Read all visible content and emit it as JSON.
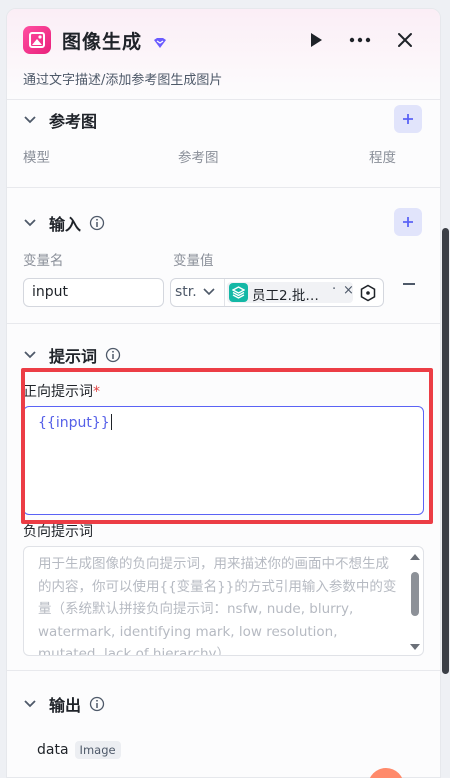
{
  "header": {
    "title": "图像生成",
    "subtitle": "通过文字描述/添加参考图生成图片",
    "icons": [
      "image-app-icon",
      "badge-icon",
      "play-icon",
      "more-icon",
      "close-icon"
    ]
  },
  "reference": {
    "title": "参考图",
    "columns": [
      "模型",
      "参考图",
      "程度"
    ]
  },
  "inputs": {
    "title": "输入",
    "col_name": "变量名",
    "col_value": "变量值",
    "row": {
      "name": "input",
      "type": "str.",
      "ref": "员工2.批…",
      "ref_dot": "·",
      "ref_close": "×"
    }
  },
  "prompt": {
    "title": "提示词",
    "positive_label": "正向提示词",
    "required_mark": "*",
    "positive_value": "{{input}}",
    "negative_label": "负向提示词",
    "negative_placeholder": "用于生成图像的负向提示词，用来描述你的画面中不想生成的内容，你可以使用{{变量名}}的方式引用输入参数中的变量（系统默认拼接负向提示词：nsfw, nude, blurry, watermark, identifying mark, low resolution, mutated, lack of hierarchy）"
  },
  "output": {
    "title": "输出",
    "name": "data",
    "type": "Image"
  },
  "colors": {
    "accent": "#5b63f5",
    "highlight": "#ec3d45",
    "brand": "#e9207b",
    "ref_icon": "#14b8a6"
  }
}
